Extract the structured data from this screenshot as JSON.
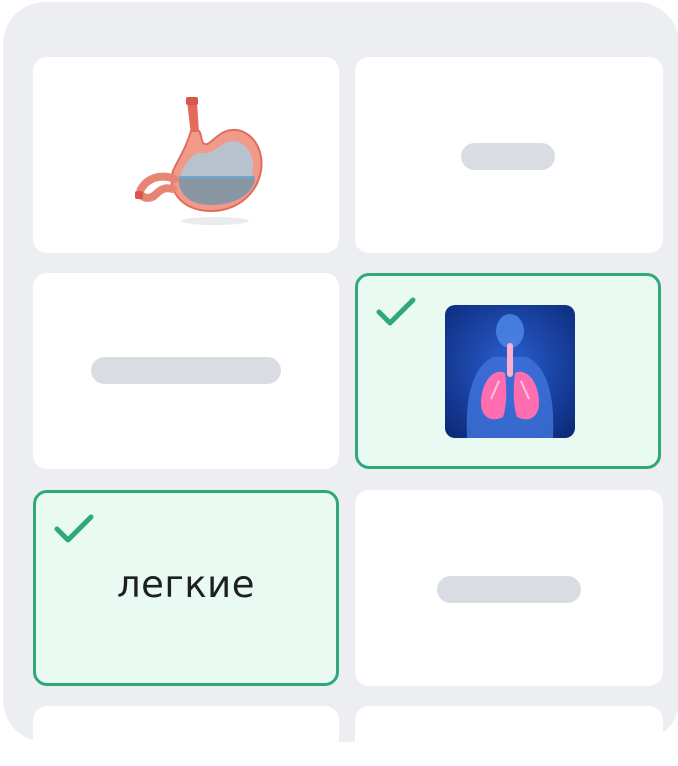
{
  "cards": [
    {
      "id": "stomach",
      "kind": "image",
      "icon": "stomach-image",
      "selected": false
    },
    {
      "id": "hidden-top-right",
      "kind": "placeholder",
      "selected": false
    },
    {
      "id": "hidden-middle-left",
      "kind": "placeholder",
      "selected": false
    },
    {
      "id": "lungs",
      "kind": "image",
      "icon": "lungs-image",
      "selected": true
    },
    {
      "id": "lungs-word",
      "kind": "text",
      "label": "легкие",
      "selected": true
    },
    {
      "id": "hidden-bottom-right",
      "kind": "placeholder",
      "selected": false
    }
  ],
  "colors": {
    "panel": "#eceef2",
    "card": "#ffffff",
    "selected_fill": "#e9faf3",
    "selected_border": "#2fa87a",
    "placeholder": "#d9dce3",
    "text": "#1e1f23"
  }
}
